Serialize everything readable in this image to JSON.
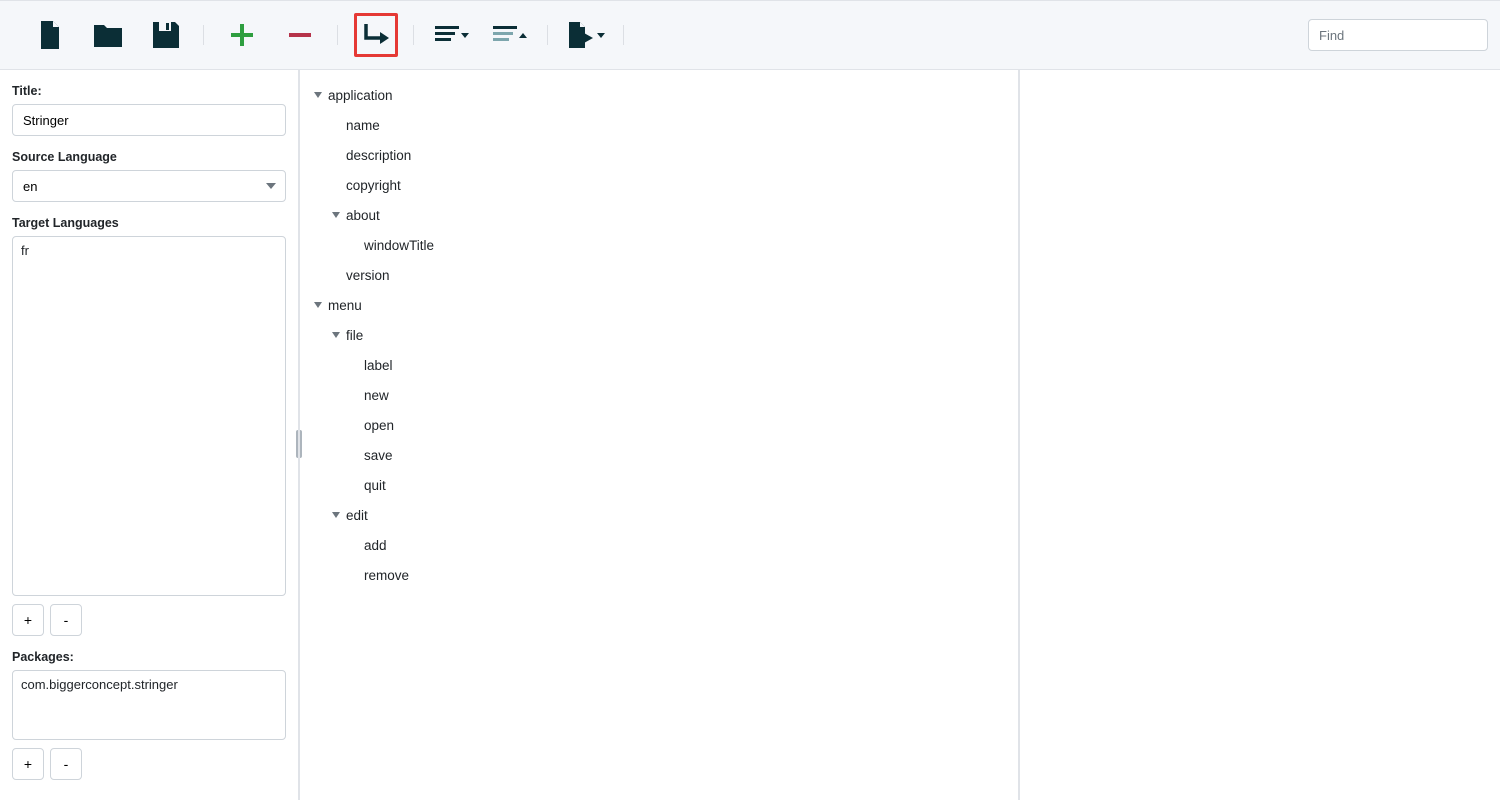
{
  "toolbar": {
    "find_placeholder": "Find"
  },
  "sidebar": {
    "title_label": "Title:",
    "title_value": "Stringer",
    "source_lang_label": "Source Language",
    "source_lang_value": "en",
    "target_lang_label": "Target Languages",
    "target_lang_items": [
      "fr"
    ],
    "add_label": "+",
    "remove_label": "-",
    "packages_label": "Packages:",
    "packages_items": [
      "com.biggerconcept.stringer"
    ]
  },
  "tree": [
    {
      "depth": 0,
      "expandable": true,
      "label": "application"
    },
    {
      "depth": 1,
      "expandable": false,
      "label": "name"
    },
    {
      "depth": 1,
      "expandable": false,
      "label": "description"
    },
    {
      "depth": 1,
      "expandable": false,
      "label": "copyright"
    },
    {
      "depth": 1,
      "expandable": true,
      "label": "about"
    },
    {
      "depth": 2,
      "expandable": false,
      "label": "windowTitle"
    },
    {
      "depth": 1,
      "expandable": false,
      "label": "version"
    },
    {
      "depth": 0,
      "expandable": true,
      "label": "menu"
    },
    {
      "depth": 1,
      "expandable": true,
      "label": "file"
    },
    {
      "depth": 2,
      "expandable": false,
      "label": "label"
    },
    {
      "depth": 2,
      "expandable": false,
      "label": "new"
    },
    {
      "depth": 2,
      "expandable": false,
      "label": "open"
    },
    {
      "depth": 2,
      "expandable": false,
      "label": "save"
    },
    {
      "depth": 2,
      "expandable": false,
      "label": "quit"
    },
    {
      "depth": 1,
      "expandable": true,
      "label": "edit"
    },
    {
      "depth": 2,
      "expandable": false,
      "label": "add"
    },
    {
      "depth": 2,
      "expandable": false,
      "label": "remove"
    }
  ]
}
